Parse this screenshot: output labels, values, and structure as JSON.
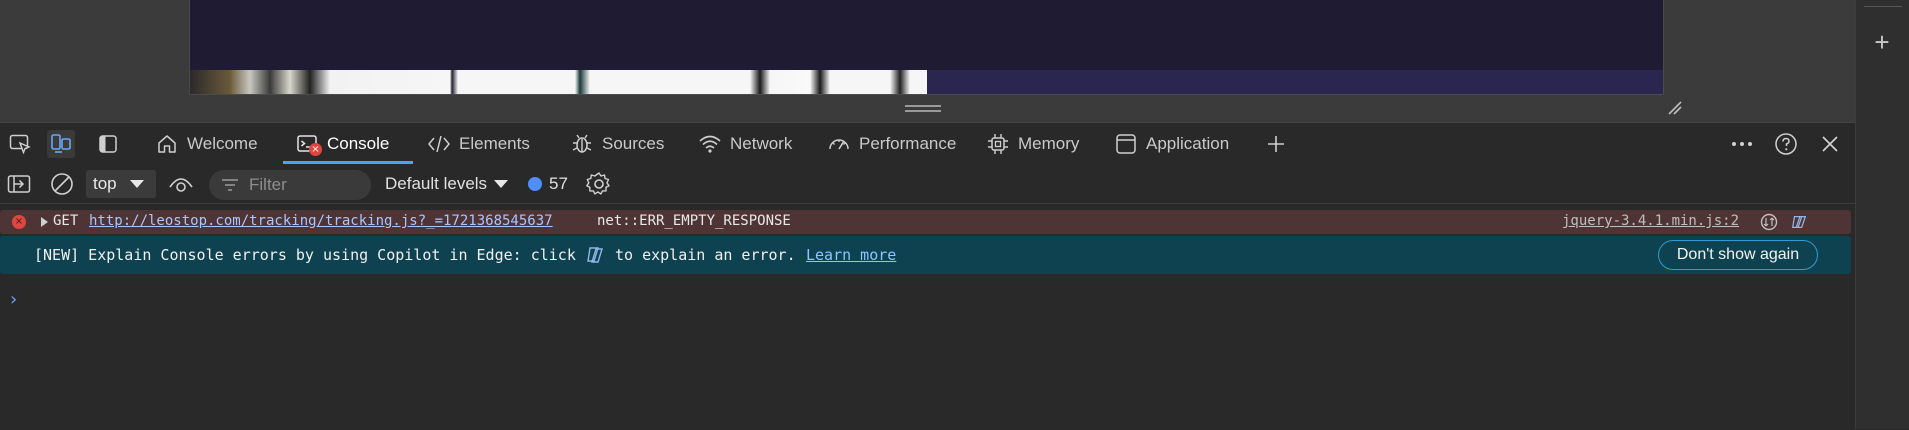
{
  "tabs": [
    {
      "label": "Welcome",
      "icon": "home-icon"
    },
    {
      "label": "Console",
      "icon": "console-icon",
      "selected": true
    },
    {
      "label": "Elements",
      "icon": "code-icon"
    },
    {
      "label": "Sources",
      "icon": "bug-icon"
    },
    {
      "label": "Network",
      "icon": "wifi-icon"
    },
    {
      "label": "Performance",
      "icon": "gauge-icon"
    },
    {
      "label": "Memory",
      "icon": "chip-icon"
    },
    {
      "label": "Application",
      "icon": "window-icon"
    }
  ],
  "console_tab_error_badge": "×",
  "toolbar": {
    "context": "top",
    "filter_placeholder": "Filter",
    "levels": "Default levels",
    "message_count": "57"
  },
  "error_row": {
    "icon_glyph": "×",
    "method": "GET",
    "url": "http://leostop.com/tracking/tracking.js?_=1721368545637",
    "status": "net::ERR_EMPTY_RESPONSE",
    "source": "jquery-3.4.1.min.js:2"
  },
  "info_row": {
    "text_before": "[NEW] Explain Console errors by using Copilot in Edge: click",
    "text_after": "to explain an error.",
    "link": "Learn more",
    "button": "Don't show again"
  },
  "prompt_glyph": "›",
  "gutter_plus": "+",
  "colors": {
    "accent": "#4aa3ff",
    "error_bg": "#4e3434",
    "info_bg": "#0f4250",
    "error_icon": "#e0463f"
  }
}
